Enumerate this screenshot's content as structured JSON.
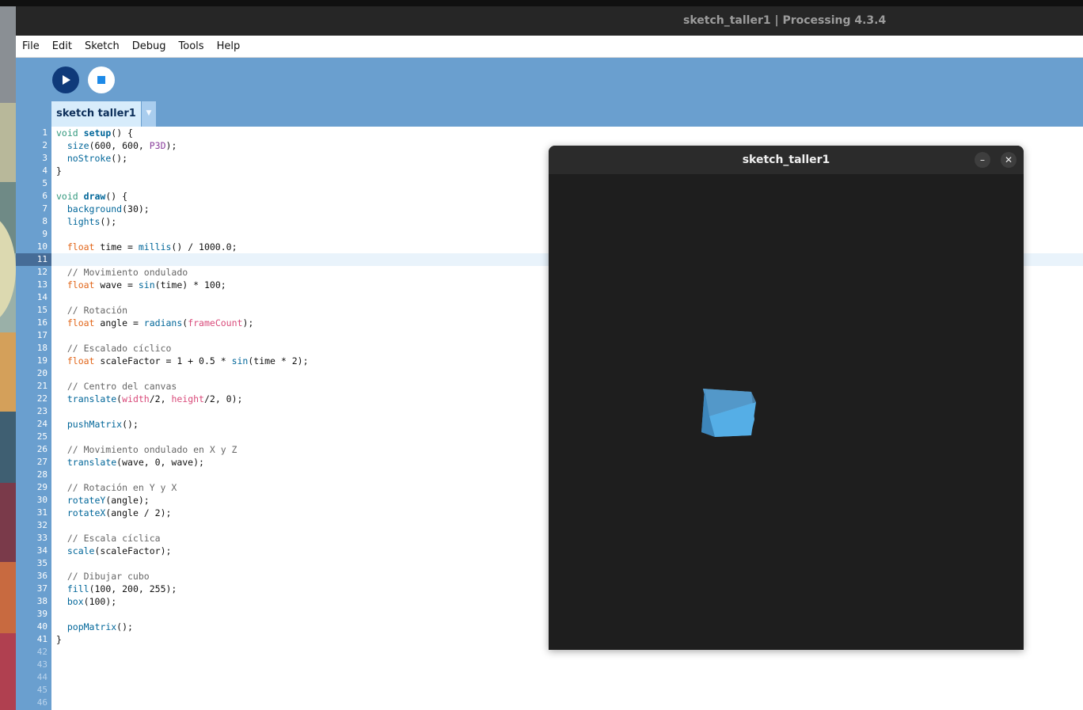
{
  "window": {
    "title": "sketch_taller1 | Processing 4.3.4"
  },
  "menu": [
    "File",
    "Edit",
    "Sketch",
    "Debug",
    "Tools",
    "Help"
  ],
  "toolbar": {
    "run_icon": "play-icon",
    "stop_icon": "stop-icon"
  },
  "tabs": [
    {
      "label": "sketch taller1"
    }
  ],
  "tab_menu_icon": "▼",
  "editor": {
    "current_line": 11,
    "line_numbers": [
      "1",
      "2",
      "3",
      "4",
      "5",
      "6",
      "7",
      "8",
      "9",
      "10",
      "11",
      "12",
      "13",
      "14",
      "15",
      "16",
      "17",
      "18",
      "19",
      "20",
      "21",
      "22",
      "23",
      "24",
      "25",
      "26",
      "27",
      "28",
      "29",
      "30",
      "31",
      "32",
      "33",
      "34",
      "35",
      "36",
      "37",
      "38",
      "39",
      "40",
      "41",
      "42",
      "43",
      "44",
      "45",
      "46"
    ],
    "code": [
      "void setup() {",
      "  size(600, 600, P3D);",
      "  noStroke();",
      "}",
      "",
      "void draw() {",
      "  background(30);",
      "  lights();",
      "",
      "  float time = millis() / 1000.0;",
      "",
      "  // Movimiento ondulado",
      "  float wave = sin(time) * 100;",
      "",
      "  // Rotación",
      "  float angle = radians(frameCount);",
      "",
      "  // Escalado cíclico",
      "  float scaleFactor = 1 + 0.5 * sin(time * 2);",
      "",
      "  // Centro del canvas",
      "  translate(width/2, height/2, 0);",
      "",
      "  pushMatrix();",
      "",
      "  // Movimiento ondulado en X y Z",
      "  translate(wave, 0, wave);",
      "",
      "  // Rotación en Y y X",
      "  rotateY(angle);",
      "  rotateX(angle / 2);",
      "",
      "  // Escala cíclica",
      "  scale(scaleFactor);",
      "",
      "  // Dibujar cubo",
      "  fill(100, 200, 255);",
      "  box(100);",
      "",
      "  popMatrix();",
      "}"
    ]
  },
  "sketch_window": {
    "title": "sketch_taller1",
    "minimize_icon": "–",
    "close_icon": "✕",
    "cube_color": "#55aee6"
  },
  "colors": {
    "toolbar": "#6a9fcf",
    "titlebar": "#262626",
    "canvas_bg": "#1e1e1e"
  }
}
